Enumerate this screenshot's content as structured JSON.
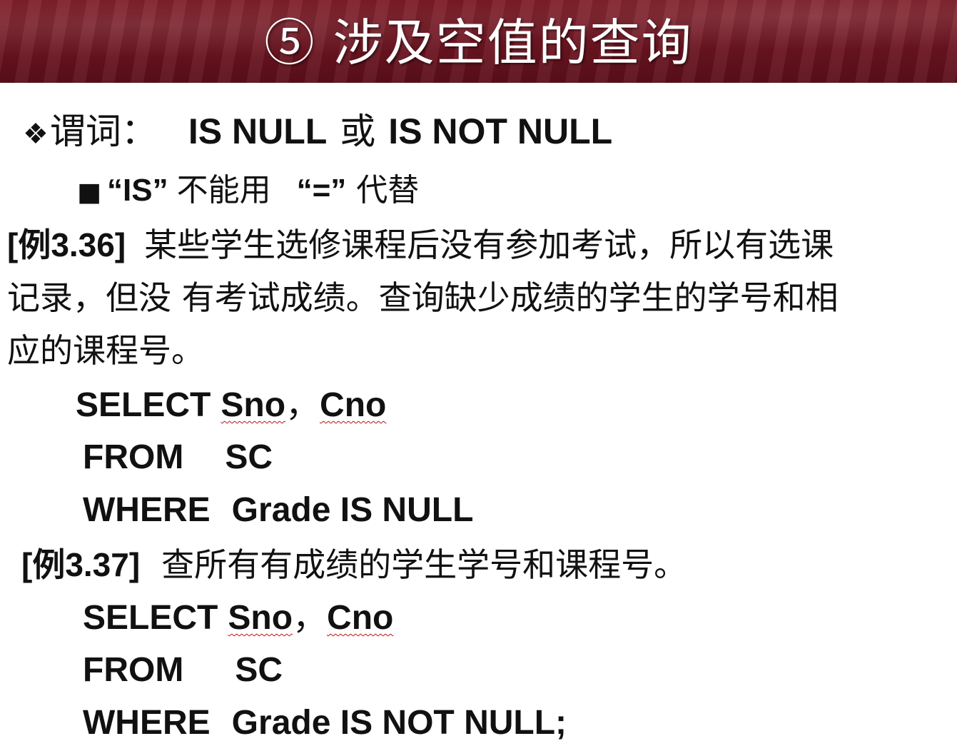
{
  "title": "⑤ 涉及空值的查询",
  "predicate": {
    "bullet": "❖",
    "label": "谓词：",
    "is_null": "IS NULL",
    "or": "或",
    "is_not_null": "IS NOT NULL"
  },
  "note": {
    "bullet": "■",
    "is_quoted": "“IS”",
    "cannot_use": "不能用",
    "eq_quoted": "“=”",
    "replace": "代替"
  },
  "example_36": {
    "tag": "[例3.36]",
    "line1": "某些学生选修课程后没有参加考试，所以有选课",
    "line2": "记录，但没 有考试成绩。查询缺少成绩的学生的学号和相",
    "line3": "应的课程号。",
    "sql": {
      "select_kw": "SELECT",
      "col1": "Sno",
      "comma": "，",
      "col2": "Cno",
      "from_kw": "FROM",
      "table": "SC",
      "where_kw": "WHERE",
      "condition": "Grade IS NULL"
    }
  },
  "example_37": {
    "tag": "[例3.37]",
    "text": "查所有有成绩的学生学号和课程号。",
    "sql": {
      "select_kw": "SELECT",
      "col1": "Sno",
      "comma": "，",
      "col2": "Cno",
      "from_kw": "FROM",
      "table": "SC",
      "where_kw": "WHERE",
      "condition": "Grade IS NOT NULL;"
    }
  },
  "colors": {
    "header_bg": "#6a1420",
    "header_text": "#ffffff",
    "body_text": "#111111",
    "squiggle": "#c01010"
  }
}
